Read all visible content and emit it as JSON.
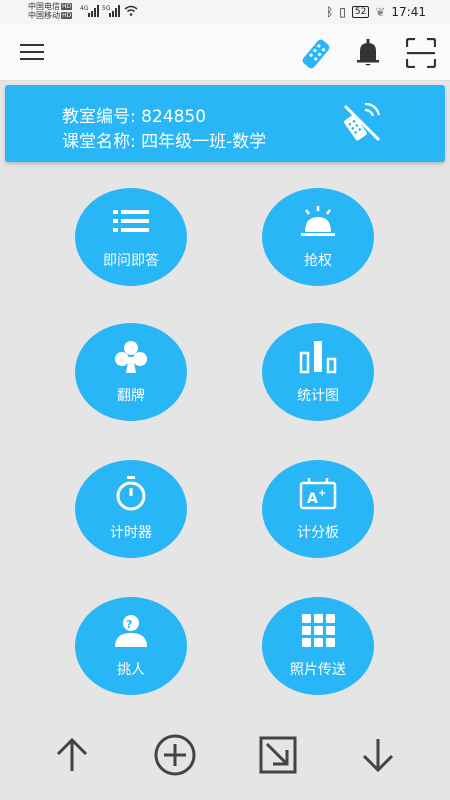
{
  "status_bar": {
    "carrier1": "中国电信",
    "carrier2": "中国移动",
    "hd_badge": "HD",
    "net1": "4G",
    "net2": "5G",
    "battery": "52",
    "time": "17:41"
  },
  "toolbar_icons": [
    "menu-icon",
    "remote-control-icon",
    "bell-icon",
    "scan-icon"
  ],
  "classroom": {
    "number_label": "教室编号: ",
    "number_value": "824850",
    "name_label": "课堂名称: ",
    "name_value": "四年级一班-数学",
    "connection_icon": "no-signal-icon"
  },
  "features": [
    {
      "label": "即问即答",
      "icon": "list-icon"
    },
    {
      "label": "抢权",
      "icon": "service-bell-icon"
    },
    {
      "label": "翻牌",
      "icon": "club-card-icon"
    },
    {
      "label": "统计图",
      "icon": "bar-chart-icon"
    },
    {
      "label": "计时器",
      "icon": "stopwatch-icon"
    },
    {
      "label": "计分板",
      "icon": "scoreboard-icon"
    },
    {
      "label": "挑人",
      "icon": "person-question-icon"
    },
    {
      "label": "照片传送",
      "icon": "grid-photos-icon"
    }
  ],
  "bottom_tools": [
    "arrow-up-icon",
    "add-circle-icon",
    "collapse-arrow-icon",
    "arrow-down-icon"
  ],
  "colors": {
    "accent": "#29b6f6",
    "background": "#e5e5e5",
    "icon_dark": "#333333"
  }
}
